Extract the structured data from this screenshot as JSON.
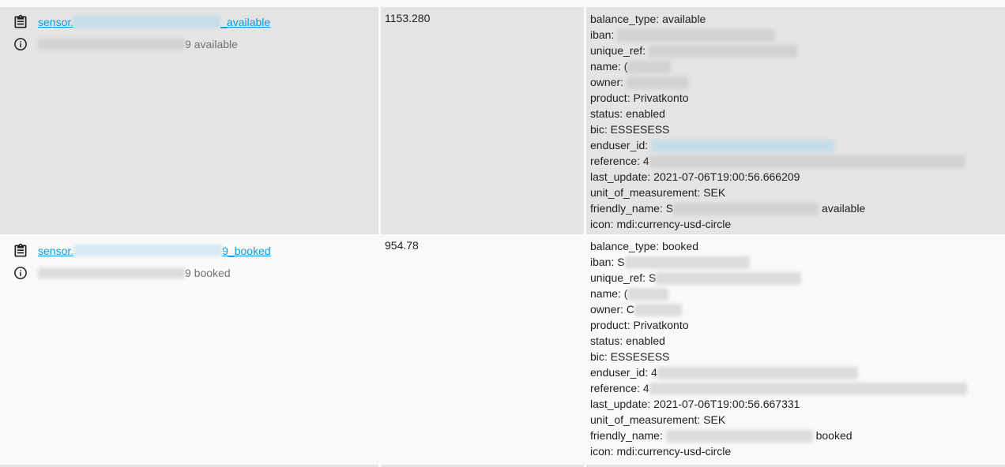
{
  "rows": [
    {
      "entity_prefix": "sensor.",
      "entity_suffix": "_available",
      "friendly_suffix": "9 available",
      "state": "1153.280",
      "attributes": [
        {
          "key": "balance_type:",
          "value": " available"
        },
        {
          "key": "iban:",
          "value": ""
        },
        {
          "key": "unique_ref:",
          "value": ""
        },
        {
          "key": "name:",
          "value": " (",
          "redact": 55
        },
        {
          "key": "owner:",
          "value": ""
        },
        {
          "key": "product:",
          "value": " Privatkonto"
        },
        {
          "key": "status:",
          "value": " enabled"
        },
        {
          "key": "bic:",
          "value": " ESSESESS"
        },
        {
          "key": "enduser_id:",
          "value": ""
        },
        {
          "key": "reference:",
          "value": " 4"
        },
        {
          "key": "last_update:",
          "value": " 2021-07-06T19:00:56.666209"
        },
        {
          "key": "unit_of_measurement:",
          "value": " SEK"
        },
        {
          "key": "friendly_name:",
          "value": " S",
          "tail": " available"
        },
        {
          "key": "icon:",
          "value": " mdi:currency-usd-circle"
        }
      ]
    },
    {
      "entity_prefix": "sensor.",
      "entity_suffix": "9_booked",
      "friendly_suffix": "9 booked",
      "state": "954.78",
      "attributes": [
        {
          "key": "balance_type:",
          "value": " booked"
        },
        {
          "key": "iban:",
          "value": " S"
        },
        {
          "key": "unique_ref:",
          "value": " S"
        },
        {
          "key": "name:",
          "value": " ("
        },
        {
          "key": "owner:",
          "value": " C"
        },
        {
          "key": "product:",
          "value": " Privatkonto"
        },
        {
          "key": "status:",
          "value": " enabled"
        },
        {
          "key": "bic:",
          "value": " ESSESESS"
        },
        {
          "key": "enduser_id:",
          "value": " 4"
        },
        {
          "key": "reference:",
          "value": " 4"
        },
        {
          "key": "last_update:",
          "value": " 2021-07-06T19:00:56.667331"
        },
        {
          "key": "unit_of_measurement:",
          "value": " SEK"
        },
        {
          "key": "friendly_name:",
          "value": "",
          "tail": " booked"
        },
        {
          "key": "icon:",
          "value": " mdi:currency-usd-circle"
        }
      ]
    }
  ],
  "icons": {
    "copy": "clipboard-text-icon",
    "info": "information-outline-icon"
  },
  "colors": {
    "link": "#039be5",
    "row_alt": "#e4e4e4",
    "row_base": "#f9f9f9"
  }
}
